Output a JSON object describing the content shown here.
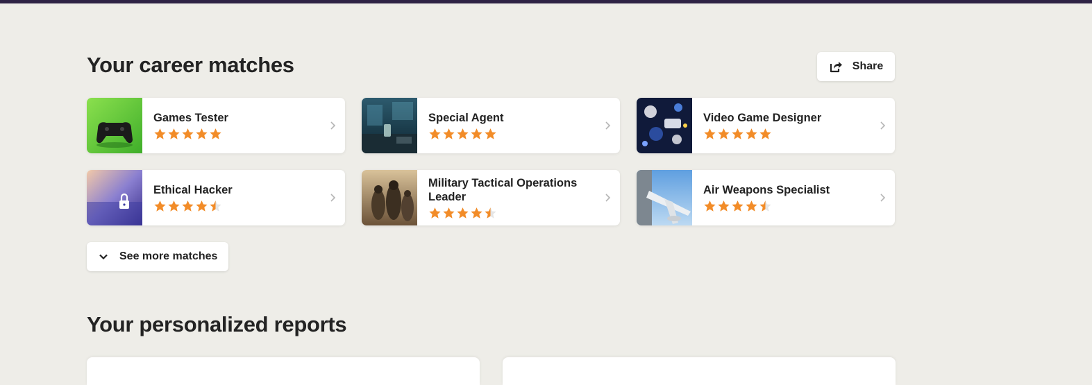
{
  "career_matches": {
    "title": "Your career matches",
    "share_label": "Share",
    "see_more_label": "See more matches",
    "items": [
      {
        "title": "Games Tester",
        "rating": 5
      },
      {
        "title": "Special Agent",
        "rating": 5
      },
      {
        "title": "Video Game Designer",
        "rating": 5
      },
      {
        "title": "Ethical Hacker",
        "rating": 4.5
      },
      {
        "title": "Military Tactical Operations Leader",
        "rating": 4.5
      },
      {
        "title": "Air Weapons Specialist",
        "rating": 4.5
      }
    ]
  },
  "reports": {
    "title": "Your personalized reports"
  },
  "icons": {
    "share": "share-icon",
    "chevron_right": "chevron-right-icon",
    "chevron_down": "chevron-down-icon",
    "star": "star-icon"
  },
  "colors": {
    "star": "#f28c28",
    "star_empty": "#e5e5e5",
    "top_bar": "#2e2345",
    "background": "#eeede8"
  }
}
